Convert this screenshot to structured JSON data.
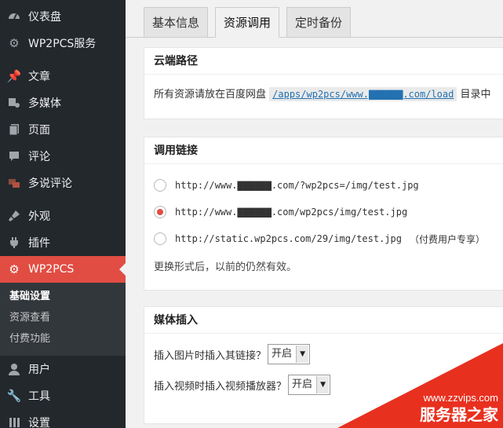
{
  "sidebar": {
    "items_top": [
      {
        "label": "仪表盘",
        "icon": "dashboard-icon"
      },
      {
        "label": "WP2PCS服务",
        "icon": "gear-icon"
      }
    ],
    "items_content": [
      {
        "label": "文章",
        "icon": "pin-icon"
      },
      {
        "label": "多媒体",
        "icon": "media-icon"
      },
      {
        "label": "页面",
        "icon": "page-icon"
      },
      {
        "label": "评论",
        "icon": "comment-icon"
      },
      {
        "label": "多说评论",
        "icon": "duoshuo-icon"
      }
    ],
    "items_appearance": [
      {
        "label": "外观",
        "icon": "brush-icon"
      },
      {
        "label": "插件",
        "icon": "plugin-icon"
      }
    ],
    "active": {
      "label": "WP2PCS",
      "icon": "gear-icon"
    },
    "submenu": [
      {
        "label": "基础设置",
        "current": true
      },
      {
        "label": "资源查看",
        "current": false
      },
      {
        "label": "付费功能",
        "current": false
      }
    ],
    "items_bottom": [
      {
        "label": "用户",
        "icon": "user-icon"
      },
      {
        "label": "工具",
        "icon": "wrench-icon"
      },
      {
        "label": "设置",
        "icon": "settings-icon"
      }
    ]
  },
  "tabs": [
    {
      "label": "基本信息",
      "active": false
    },
    {
      "label": "资源调用",
      "active": true
    },
    {
      "label": "定时备份",
      "active": false
    }
  ],
  "cloud_path": {
    "title": "云端路径",
    "prefix": "所有资源请放在百度网盘",
    "path": "/apps/wp2pcs/www.▇▇▇▇▇▇.com/load",
    "suffix": "目录中"
  },
  "call_link": {
    "title": "调用链接",
    "options": [
      {
        "url": "http://www.▇▇▇▇▇▇.com/?wp2pcs=/img/test.jpg",
        "note": "",
        "checked": false
      },
      {
        "url": "http://www.▇▇▇▇▇▇.com/wp2pcs/img/test.jpg",
        "note": "",
        "checked": true
      },
      {
        "url": "http://static.wp2pcs.com/29/img/test.jpg",
        "note": "（付费用户专享）",
        "checked": false
      }
    ],
    "hint": "更换形式后，以前的仍然有效。"
  },
  "media_insert": {
    "title": "媒体插入",
    "image_label": "插入图片时插入其链接？",
    "image_value": "开启",
    "video_label": "插入视频时插入视频播放器？",
    "video_value": "开启"
  },
  "watermark": {
    "url": "www.zzvips.com",
    "name": "服务器之家"
  },
  "colors": {
    "sidebar_bg": "#23282d",
    "active_bg": "#e14d43",
    "link": "#2271b1"
  }
}
